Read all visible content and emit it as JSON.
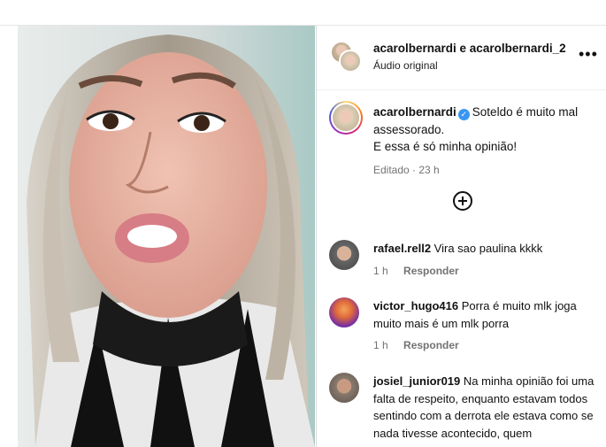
{
  "header": {
    "usernames": "acarolbernardi e acarolbernardi_2",
    "audio": "Áudio original",
    "more": "•••"
  },
  "caption": {
    "username": "acarolbernardi",
    "text_line1": "Soteldo é muito mal assessorado.",
    "text_line2": "E essa é só minha opinião!",
    "meta": "Editado · 23 h"
  },
  "comments": [
    {
      "username": "rafael.rell2",
      "text": "Vira sao paulina kkkk",
      "time": "1 h",
      "reply": "Responder"
    },
    {
      "username": "victor_hugo416",
      "text": "Porra é muito mlk joga muito mais é um mlk porra",
      "time": "1 h",
      "reply": "Responder"
    },
    {
      "username": "josiel_junior019",
      "text": "Na minha opinião foi uma falta de respeito, enquanto estavam todos sentindo com a derrota ele estava como se nada tivesse acontecido, quem"
    }
  ],
  "colors": {
    "verified": "#3897f0",
    "muted": "#737373"
  },
  "icons": {
    "more": "more-options-icon",
    "add": "add-comment-icon",
    "verified": "verified-badge-icon"
  }
}
